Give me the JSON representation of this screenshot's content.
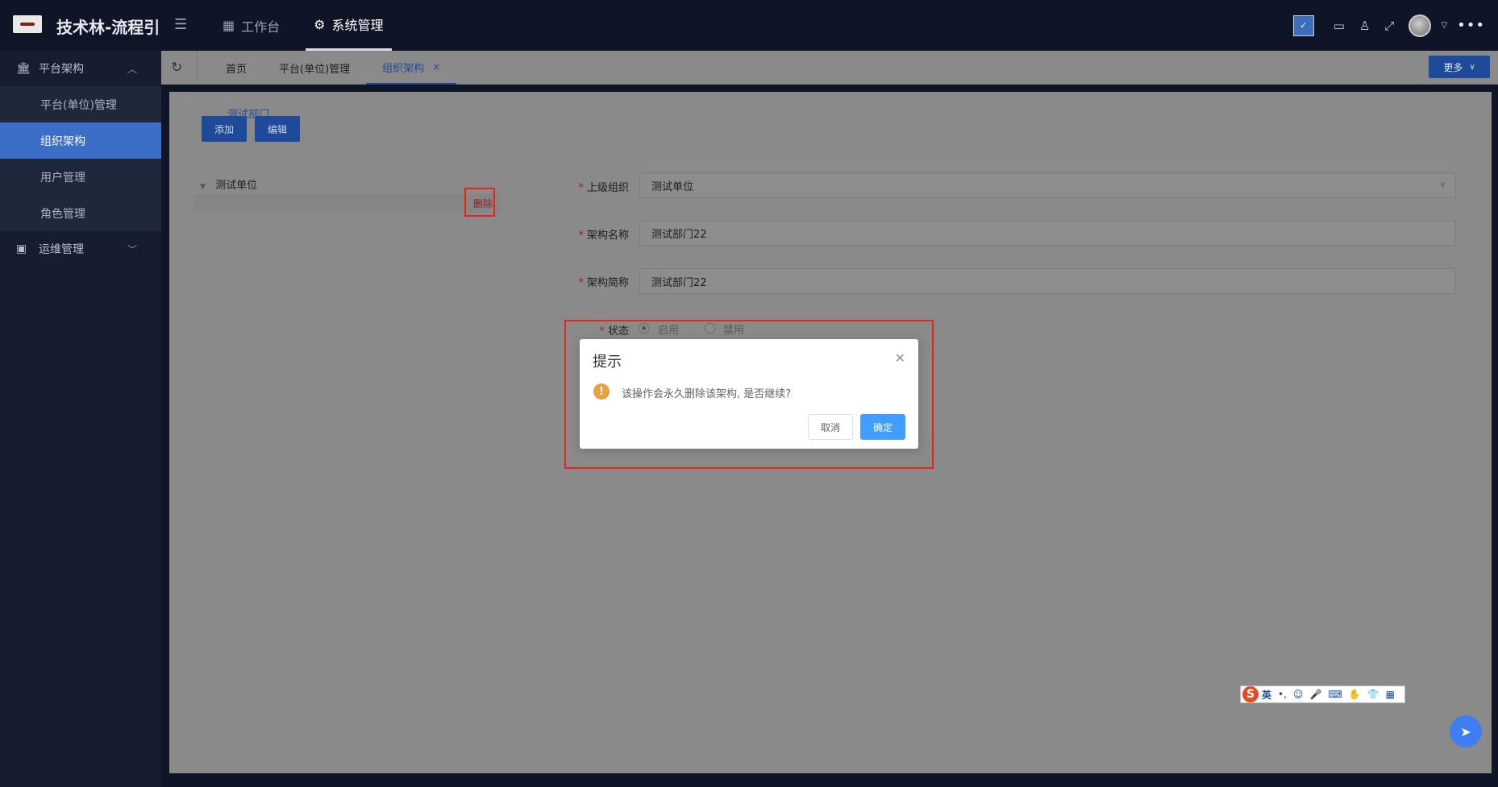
{
  "header": {
    "brand": "技术林-流程引",
    "nav": [
      {
        "label": "工作台",
        "icon": "dashboard-icon"
      },
      {
        "label": "系统管理",
        "icon": "gear-icon"
      }
    ],
    "notify_badge": "✓"
  },
  "sidebar": {
    "groups": [
      {
        "label": "平台架构",
        "icon": "bank-icon",
        "expanded": true,
        "items": [
          {
            "label": "平台(单位)管理"
          },
          {
            "label": "组织架构",
            "active": true
          },
          {
            "label": "用户管理"
          },
          {
            "label": "角色管理"
          }
        ]
      },
      {
        "label": "运维管理",
        "icon": "monitor-icon",
        "expanded": false
      }
    ]
  },
  "tabs": {
    "items": [
      {
        "label": "首页"
      },
      {
        "label": "平台(单位)管理"
      },
      {
        "label": "组织架构",
        "active": true
      }
    ],
    "more_label": "更多"
  },
  "toolbar": {
    "add_label": "添加",
    "edit_label": "编辑"
  },
  "tree": {
    "root": "测试单位",
    "child": "测试部门",
    "delete_label": "删除"
  },
  "form": {
    "parent_label": "上级组织",
    "parent_value": "测试单位",
    "name_label": "架构名称",
    "name_value": "测试部门22",
    "short_label": "架构简称",
    "short_value": "测试部门22",
    "status_label": "状态",
    "status_on": "启用",
    "status_off": "禁用"
  },
  "dialog": {
    "title": "提示",
    "message": "该操作会永久删除该架构, 是否继续?",
    "cancel_label": "取消",
    "ok_label": "确定"
  },
  "ime": {
    "logo": "S",
    "mode": "英"
  },
  "colors": {
    "sidebar_active": "#3b6ec7",
    "primary_button": "#409eff",
    "highlight_border": "#e8231c",
    "warning": "#e6a23c"
  }
}
